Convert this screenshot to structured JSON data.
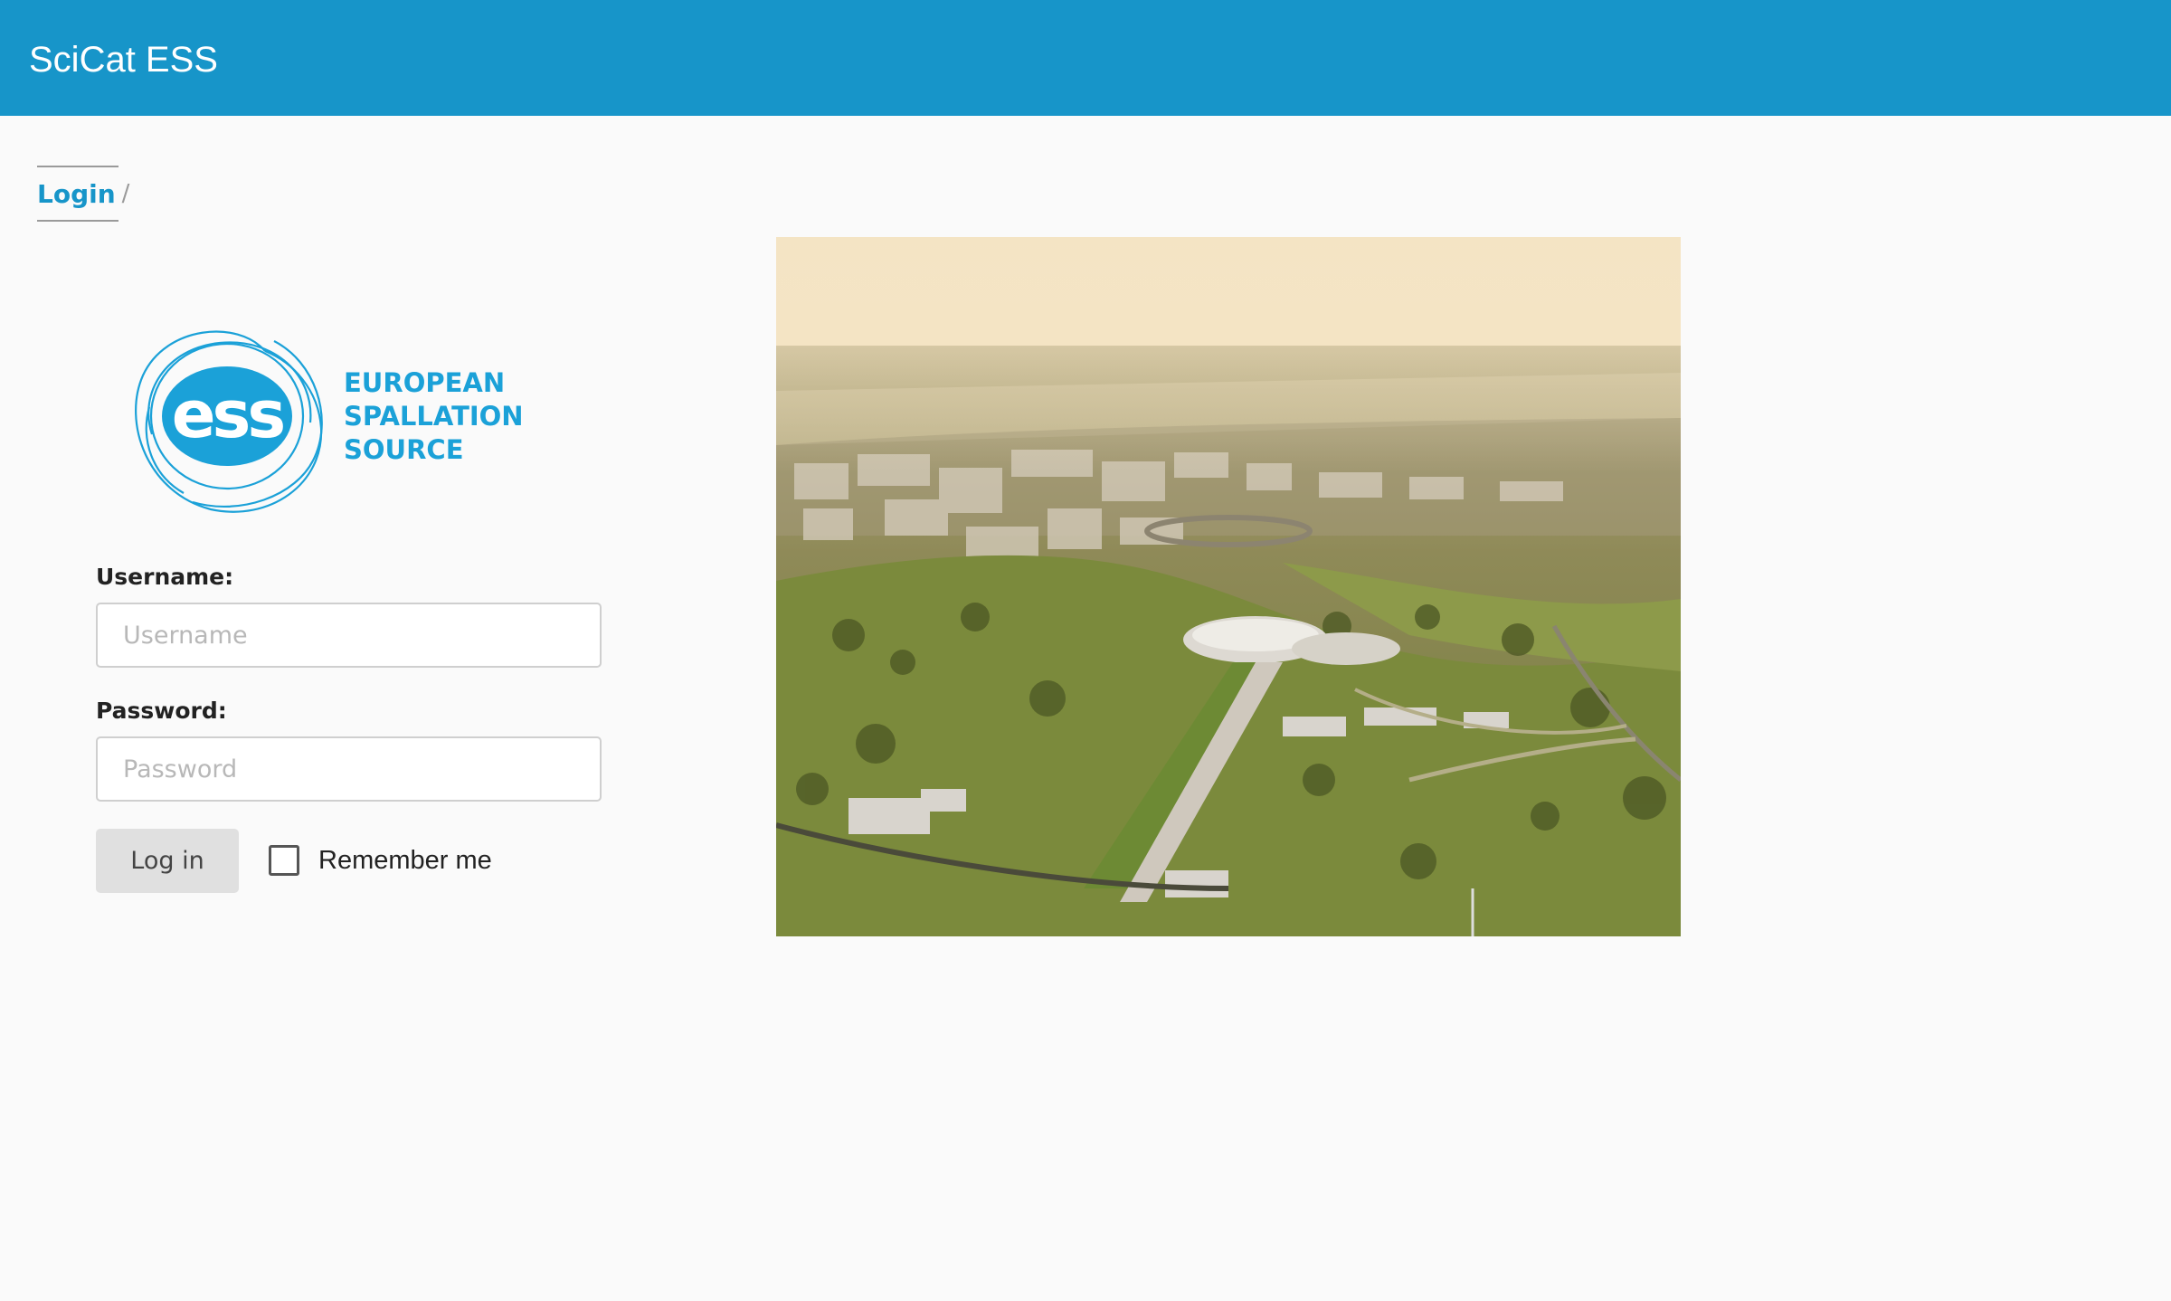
{
  "header": {
    "app_title": "SciCat ESS",
    "background_color": "#1795c9"
  },
  "breadcrumb": {
    "current": "Login",
    "separator": "/"
  },
  "logo": {
    "monogram": "ess",
    "lines": [
      "EUROPEAN",
      "SPALLATION",
      "SOURCE"
    ],
    "color": "#1ba1d8"
  },
  "form": {
    "username_label": "Username:",
    "username_placeholder": "Username",
    "username_value": "",
    "password_label": "Password:",
    "password_placeholder": "Password",
    "password_value": "",
    "login_button": "Log in",
    "remember_label": "Remember me",
    "remember_checked": false
  },
  "photo": {
    "subject": "aerial-view-of-ess-facility"
  }
}
